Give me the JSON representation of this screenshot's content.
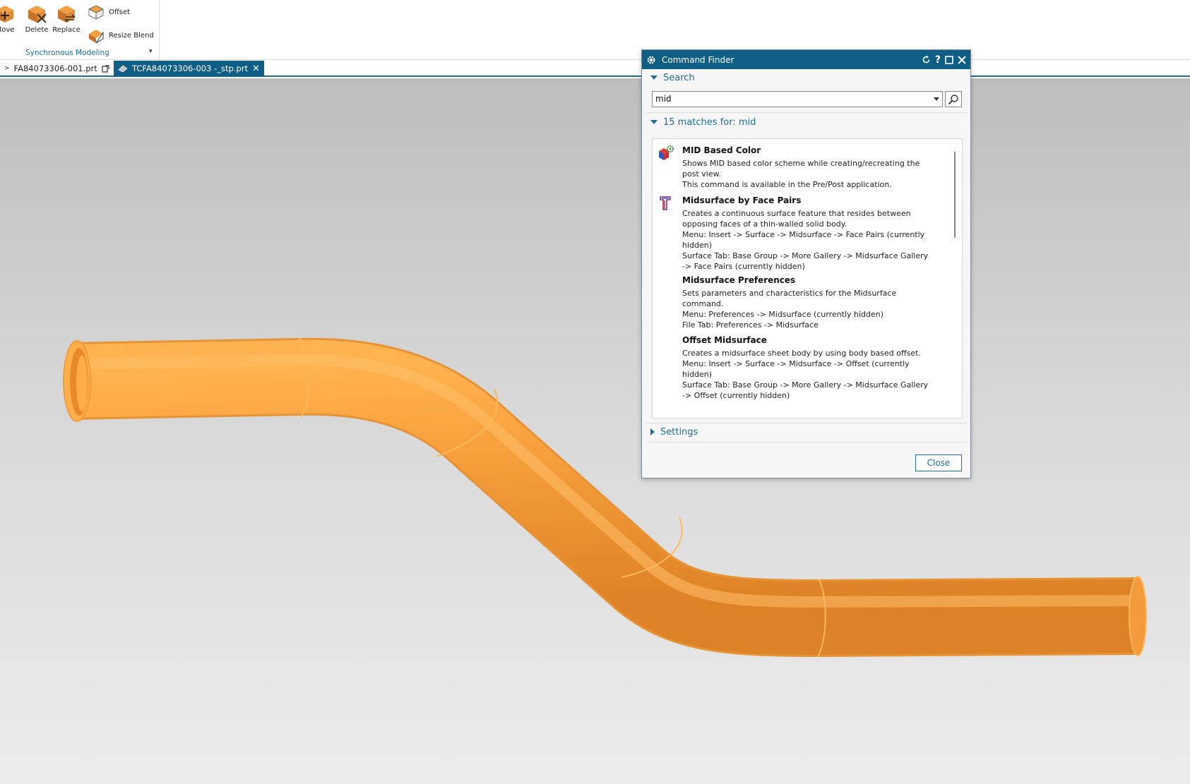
{
  "ribbon": {
    "buttons": [
      {
        "label": "Move",
        "icon": "move-face-icon"
      },
      {
        "label": "Delete",
        "icon": "delete-face-icon"
      },
      {
        "label": "Replace",
        "icon": "replace-face-icon"
      }
    ],
    "small_buttons": [
      {
        "label": "Offset",
        "icon": "offset-region-icon"
      },
      {
        "label": "Resize Blend",
        "icon": "resize-blend-icon"
      }
    ],
    "group_label": "Synchronous Modeling"
  },
  "tabs": [
    {
      "label": "FA84073306-001.prt",
      "active": false
    },
    {
      "label": "TCFA84073306-003 -_stp.prt",
      "active": true
    }
  ],
  "dialog": {
    "title": "Command Finder",
    "search_section": "Search",
    "search_value": "mid",
    "results_header": "15 matches for: mid",
    "results": [
      {
        "name": "MID Based Color",
        "icon": "mid-color-icon",
        "lines": [
          "Shows MID based color scheme while creating/recreating the",
          "post view.",
          "This command is available in the Pre/Post application."
        ]
      },
      {
        "name": "Midsurface by Face Pairs",
        "icon": "midsurface-face-pairs-icon",
        "lines": [
          "Creates a continuous surface feature that resides between",
          "opposing faces of a thin-walled solid body.",
          "Menu: Insert -> Surface -> Midsurface -> Face Pairs (currently",
          "hidden)",
          "Surface Tab: Base Group -> More Gallery -> Midsurface Gallery",
          "-> Face Pairs (currently hidden)"
        ]
      },
      {
        "name": "Midsurface Preferences",
        "icon": "",
        "lines": [
          "Sets parameters and characteristics for the Midsurface",
          "command.",
          "Menu: Preferences -> Midsurface (currently hidden)",
          "File Tab: Preferences -> Midsurface"
        ]
      },
      {
        "name": "Offset Midsurface",
        "icon": "",
        "lines": [
          "Creates a midsurface sheet body by using body based offset.",
          "Menu: Insert -> Surface -> Midsurface -> Offset (currently",
          "hidden)",
          "Surface Tab: Base Group -> More Gallery -> Midsurface Gallery",
          "-> Offset (currently hidden)"
        ]
      }
    ],
    "settings_section": "Settings",
    "close_label": "Close"
  },
  "colors": {
    "accent": "#0e5e86",
    "link_blue": "#1e6e96",
    "pipe": "#f5a043"
  }
}
